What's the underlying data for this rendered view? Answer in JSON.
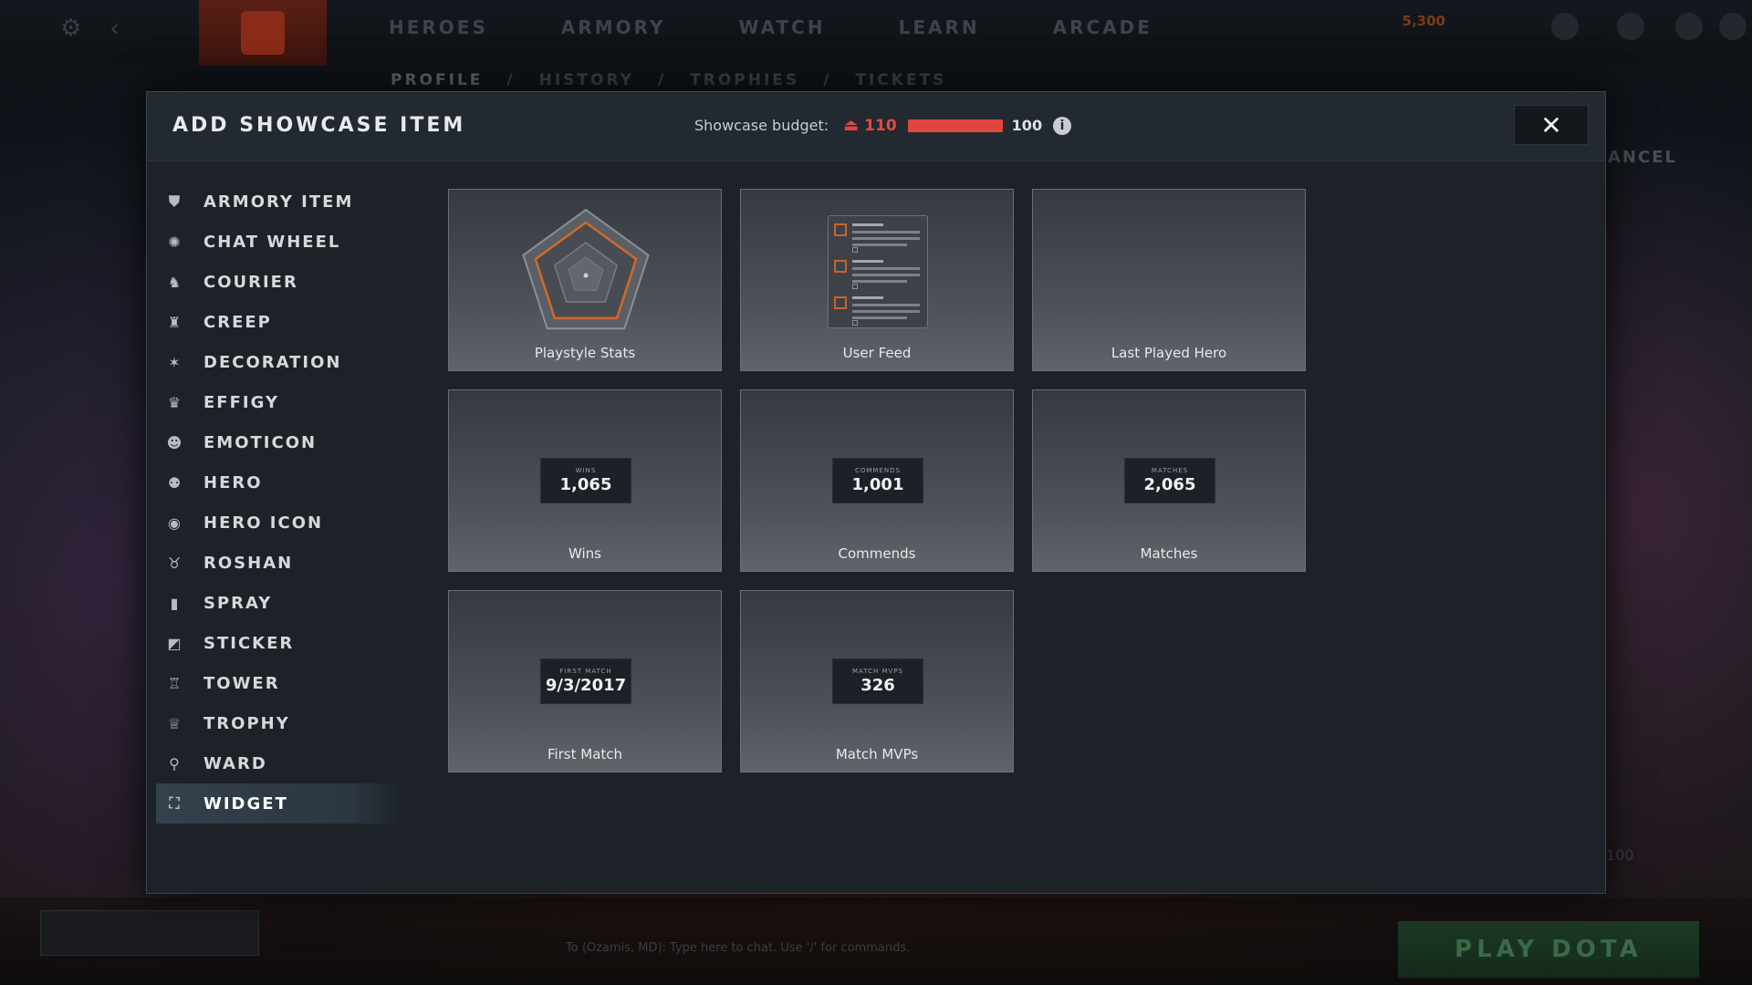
{
  "background": {
    "nav": [
      "HEROES",
      "ARMORY",
      "WATCH",
      "LEARN",
      "ARCADE"
    ],
    "subnav": [
      "PROFILE",
      "/",
      "HISTORY",
      "/",
      "TROPHIES",
      "/",
      "TICKETS"
    ],
    "gold": "5,300",
    "cancel_label": "ANCEL",
    "side_value": "100",
    "chat_text": "To (Ozamis, MD): Type here to chat. Use '/' for commands.",
    "play_label": "PLAY DOTA"
  },
  "modal": {
    "title": "ADD SHOWCASE ITEM",
    "budget": {
      "label": "Showcase budget:",
      "current": "110",
      "max": "100",
      "over_color": "#e0463e"
    },
    "close_label": "✕",
    "info_label": "i"
  },
  "categories": [
    {
      "label": "ARMORY ITEM",
      "icon": "armory-icon",
      "glyph": "⛊"
    },
    {
      "label": "CHAT WHEEL",
      "icon": "chat-wheel-icon",
      "glyph": "✺"
    },
    {
      "label": "COURIER",
      "icon": "courier-icon",
      "glyph": "♞"
    },
    {
      "label": "CREEP",
      "icon": "creep-icon",
      "glyph": "♜"
    },
    {
      "label": "DECORATION",
      "icon": "decoration-icon",
      "glyph": "✶"
    },
    {
      "label": "EFFIGY",
      "icon": "effigy-icon",
      "glyph": "♛"
    },
    {
      "label": "EMOTICON",
      "icon": "emoticon-icon",
      "glyph": "☻"
    },
    {
      "label": "HERO",
      "icon": "hero-icon",
      "glyph": "⚉"
    },
    {
      "label": "HERO ICON",
      "icon": "hero-icon-icon",
      "glyph": "◉"
    },
    {
      "label": "ROSHAN",
      "icon": "roshan-icon",
      "glyph": "♉"
    },
    {
      "label": "SPRAY",
      "icon": "spray-icon",
      "glyph": "▮"
    },
    {
      "label": "STICKER",
      "icon": "sticker-icon",
      "glyph": "◩"
    },
    {
      "label": "TOWER",
      "icon": "tower-icon",
      "glyph": "♖"
    },
    {
      "label": "TROPHY",
      "icon": "trophy-icon",
      "glyph": "♕"
    },
    {
      "label": "WARD",
      "icon": "ward-icon",
      "glyph": "⚲"
    },
    {
      "label": "WIDGET",
      "icon": "widget-icon",
      "glyph": "⛶",
      "active": true
    }
  ],
  "tiles": [
    {
      "label": "Playstyle Stats",
      "kind": "radar"
    },
    {
      "label": "User Feed",
      "kind": "feed"
    },
    {
      "label": "Last Played Hero",
      "kind": "empty"
    },
    {
      "label": "Wins",
      "kind": "stat",
      "caption": "WINS",
      "value": "1,065"
    },
    {
      "label": "Commends",
      "kind": "stat",
      "caption": "COMMENDS",
      "value": "1,001"
    },
    {
      "label": "Matches",
      "kind": "stat",
      "caption": "MATCHES",
      "value": "2,065"
    },
    {
      "label": "First Match",
      "kind": "stat",
      "caption": "FIRST MATCH",
      "value": "9/3/2017"
    },
    {
      "label": "Match MVPs",
      "kind": "stat",
      "caption": "MATCH MVPS",
      "value": "326"
    }
  ]
}
